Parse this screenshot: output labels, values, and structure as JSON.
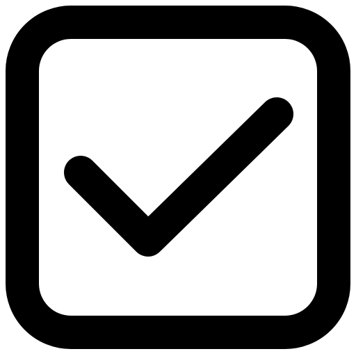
{
  "icon": {
    "name": "checkbox-checked-icon",
    "state": "checked",
    "stroke_color": "#000000",
    "background_color": "#ffffff"
  }
}
